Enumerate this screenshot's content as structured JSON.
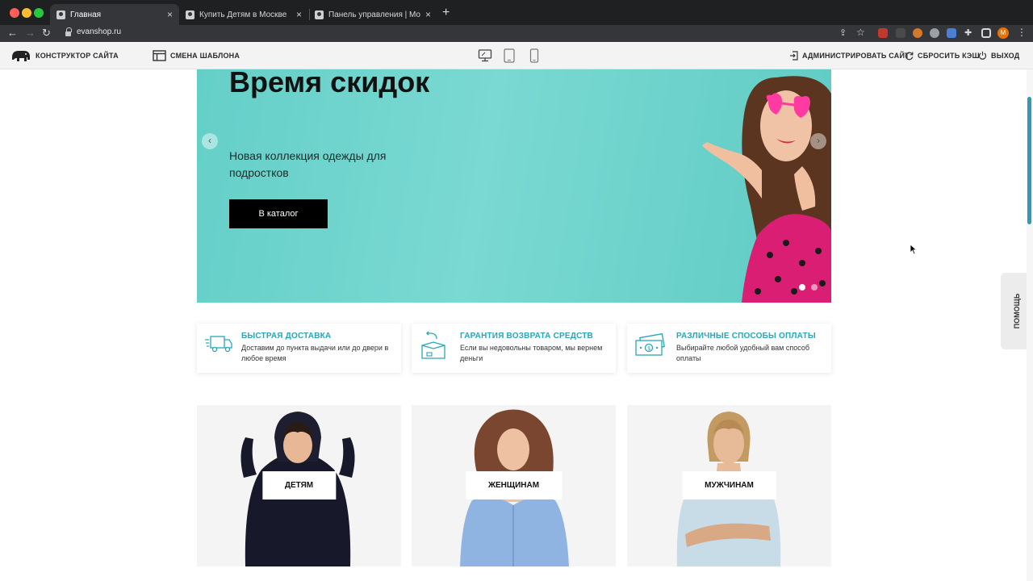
{
  "browser": {
    "tabs": [
      {
        "title": "Главная",
        "active": true
      },
      {
        "title": "Купить Детям в Москве",
        "active": false
      },
      {
        "title": "Панель управления | Moguta.",
        "active": false
      }
    ],
    "url": "evanshop.ru",
    "profile_initial": "M"
  },
  "admin_bar": {
    "constructor_label": "КОНСТРУКТОР САЙТА",
    "template_label": "СМЕНА ШАБЛОНА",
    "admin_label": "АДМИНИСТРИРОВАТЬ САЙТ",
    "cache_label": "СБРОСИТЬ КЭШ",
    "exit_label": "ВЫХОД",
    "devices": [
      "desktop-icon",
      "tablet-icon",
      "mobile-icon"
    ]
  },
  "hero": {
    "title": "Время скидок",
    "subtitle": "Новая коллекция одежды для подростков",
    "button": "В каталог",
    "active_slide": 1,
    "slides": 2
  },
  "features": [
    {
      "title": "БЫСТРАЯ ДОСТАВКА",
      "text": "Доставим до пункта выдачи или до двери в любое время",
      "icon": "delivery-truck-icon"
    },
    {
      "title": "ГАРАНТИЯ ВОЗВРАТА СРЕДСТВ",
      "text": "Если вы недовольны товаром, мы вернем деньги",
      "icon": "return-box-icon"
    },
    {
      "title": "РАЗЛИЧНЫЕ СПОСОБЫ ОПЛАТЫ",
      "text": "Выбирайте любой удобный вам способ оплаты",
      "icon": "money-icon"
    }
  ],
  "categories": [
    {
      "label": "ДЕТЯМ"
    },
    {
      "label": "ЖЕНЩИНАМ"
    },
    {
      "label": "МУЖЧИНАМ"
    }
  ],
  "help": {
    "label": "ПОМОЩЬ"
  },
  "colors": {
    "accent": "#26a7b5",
    "hero_bg": "#6fd3cc",
    "button": "#000000"
  }
}
